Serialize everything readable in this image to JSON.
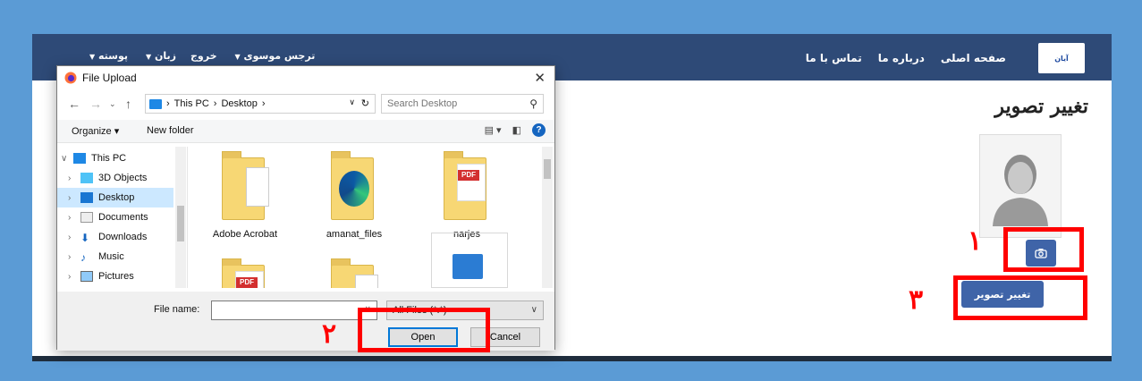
{
  "site": {
    "nav": {
      "logo_text": "آیان",
      "links": [
        "صفحه اصلی",
        "درباره ما",
        "تماس با ما"
      ],
      "left_items": [
        "ترجس موسوی",
        "خروج",
        "زبان",
        "پوسته"
      ]
    },
    "page_title": "تغییر تصویر",
    "change_button_label": "تغییر تصویر",
    "icons": {
      "camera": "camera-icon",
      "avatar": "user-avatar-icon"
    }
  },
  "annotations": {
    "step1": "۱",
    "step2": "۲",
    "step3": "۳",
    "color": "#ff0000"
  },
  "dialog": {
    "title": "File Upload",
    "close": "✕",
    "path": [
      "This PC",
      "Desktop"
    ],
    "search_placeholder": "Search Desktop",
    "toolbar": {
      "organize": "Organize ▾",
      "new_folder": "New folder",
      "help": "?"
    },
    "tree": [
      {
        "label": "This PC",
        "expanded": true
      },
      {
        "label": "3D Objects"
      },
      {
        "label": "Desktop",
        "selected": true
      },
      {
        "label": "Documents"
      },
      {
        "label": "Downloads"
      },
      {
        "label": "Music"
      },
      {
        "label": "Pictures"
      }
    ],
    "files": [
      "Adobe Acrobat",
      "amanat_files",
      "narjes"
    ],
    "file_name_label": "File name:",
    "file_name_value": "",
    "filter": "All Files (*.*)",
    "open_label": "Open",
    "cancel_label": "Cancel"
  }
}
